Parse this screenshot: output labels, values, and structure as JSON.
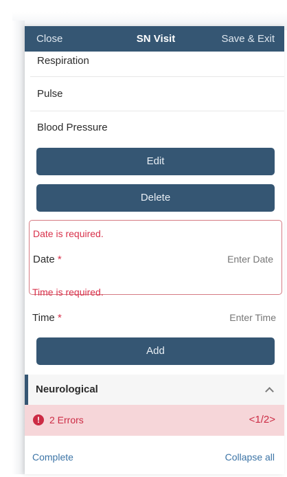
{
  "navbar": {
    "close_label": "Close",
    "title": "SN Visit",
    "save_exit_label": "Save & Exit"
  },
  "vitals": {
    "respiration": "Respiration",
    "pulse": "Pulse",
    "blood_pressure": "Blood Pressure"
  },
  "actions": {
    "edit_label": "Edit",
    "delete_label": "Delete",
    "add_label": "Add"
  },
  "date_field": {
    "error": "Date is required.",
    "label": "Date",
    "required_mark": "*",
    "placeholder": "Enter Date"
  },
  "time_field": {
    "error": "Time is required.",
    "label": "Time",
    "required_mark": "*",
    "placeholder": "Enter Time"
  },
  "section": {
    "title": "Neurological"
  },
  "errors": {
    "count_label": "2 Errors",
    "icon": "!",
    "pager": "1/2",
    "prev": "<",
    "next": ">"
  },
  "footer": {
    "complete_label": "Complete",
    "collapse_all_label": "Collapse all"
  },
  "colors": {
    "navbar": "#355673",
    "error": "#d8304a",
    "link": "#3c74a6"
  }
}
